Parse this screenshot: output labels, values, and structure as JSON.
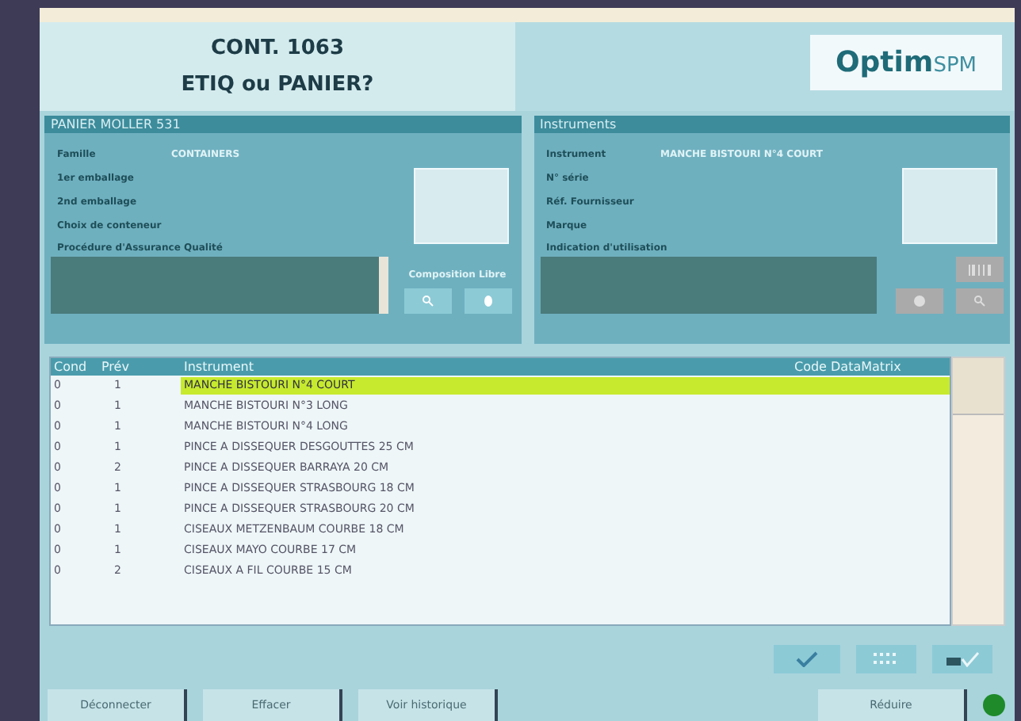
{
  "header": {
    "title": "CONT. 1063",
    "subtitle": "ETIQ ou PANIER?",
    "logo": {
      "main": "Optim",
      "suffix": "SPM"
    }
  },
  "left_panel": {
    "title": "PANIER MOLLER 531",
    "fields": [
      {
        "label": "Famille",
        "value": "CONTAINERS"
      },
      {
        "label": "1er emballage"
      },
      {
        "label": "2nd emballage"
      },
      {
        "label": "Choix de conteneur"
      }
    ],
    "notes_label": "Procédure d'Assurance Qualité",
    "side_label": "Composition Libre"
  },
  "right_panel": {
    "title": "Instruments",
    "fields": [
      {
        "label": "Instrument",
        "value": "MANCHE BISTOURI N°4 COURT"
      },
      {
        "label": "N° série"
      },
      {
        "label": "Réf. Fournisseur"
      },
      {
        "label": "Marque"
      }
    ],
    "notes_label": "Indication d'utilisation"
  },
  "table": {
    "columns": [
      "Cond",
      "Prév",
      "Instrument",
      "Code DataMatrix"
    ],
    "rows": [
      {
        "cond": "0",
        "prev": "1",
        "instrument": "MANCHE BISTOURI N°4 COURT",
        "selected": true
      },
      {
        "cond": "0",
        "prev": "1",
        "instrument": "MANCHE BISTOURI N°3 LONG",
        "selected": false
      },
      {
        "cond": "0",
        "prev": "1",
        "instrument": "MANCHE BISTOURI N°4 LONG",
        "selected": false
      },
      {
        "cond": "0",
        "prev": "1",
        "instrument": "PINCE A DISSEQUER DESGOUTTES 25 CM",
        "selected": false
      },
      {
        "cond": "0",
        "prev": "2",
        "instrument": "PINCE A DISSEQUER BARRAYA  20 CM",
        "selected": false
      },
      {
        "cond": "0",
        "prev": "1",
        "instrument": "PINCE A DISSEQUER STRASBOURG 18 CM",
        "selected": false
      },
      {
        "cond": "0",
        "prev": "1",
        "instrument": "PINCE A DISSEQUER STRASBOURG 20 CM",
        "selected": false
      },
      {
        "cond": "0",
        "prev": "1",
        "instrument": "CISEAUX METZENBAUM  COURBE 18 CM",
        "selected": false
      },
      {
        "cond": "0",
        "prev": "1",
        "instrument": "CISEAUX MAYO COURBE 17 CM",
        "selected": false
      },
      {
        "cond": "0",
        "prev": "2",
        "instrument": "CISEAUX A FIL COURBE 15 CM",
        "selected": false
      }
    ]
  },
  "footer_buttons": [
    "Déconnecter",
    "Effacer",
    "Voir historique"
  ],
  "minimize_button": "Réduire",
  "status": {
    "connected": true
  }
}
